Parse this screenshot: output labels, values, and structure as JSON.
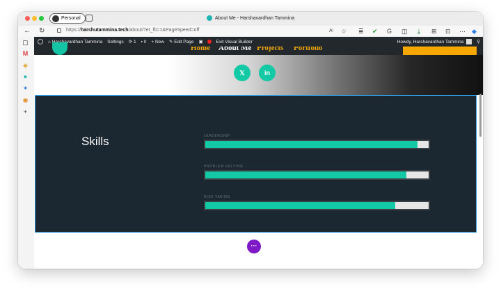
{
  "browser": {
    "profile_label": "Personal",
    "tab_title": "About Me - Harshavardhan Tammina",
    "url_prefix": "https://",
    "url_domain": "harshutammina.tech",
    "url_path": "/about/?et_fb=1&PageSpeed=off"
  },
  "wp_admin_bar": {
    "site_name": "Harshavardhan Tammina",
    "settings": "Settings",
    "updates_count": "1",
    "comments_count": "0",
    "new": "New",
    "edit_page": "Edit Page",
    "exit_builder": "Exit Visual Builder",
    "howdy": "Howdy, Harshavardhan Tammina"
  },
  "site_menu": {
    "items": [
      "Home",
      "About Me",
      "Projects",
      "Portfolio"
    ]
  },
  "social": {
    "twitter_glyph": "𝕏",
    "linkedin_glyph": "in"
  },
  "skills": {
    "title": "Skills",
    "bars": [
      {
        "label": "LEADERSHIP",
        "percent": 95
      },
      {
        "label": "PROBLEM SOLVING",
        "percent": 90
      },
      {
        "label": "RISK TAKING",
        "percent": 85
      }
    ]
  },
  "builder": {
    "more_glyph": "···"
  },
  "colors": {
    "accent_teal": "#14c9a5",
    "section_bg": "#1b2731",
    "menu_orange": "#f7a800",
    "builder_purple": "#7d19c7"
  }
}
